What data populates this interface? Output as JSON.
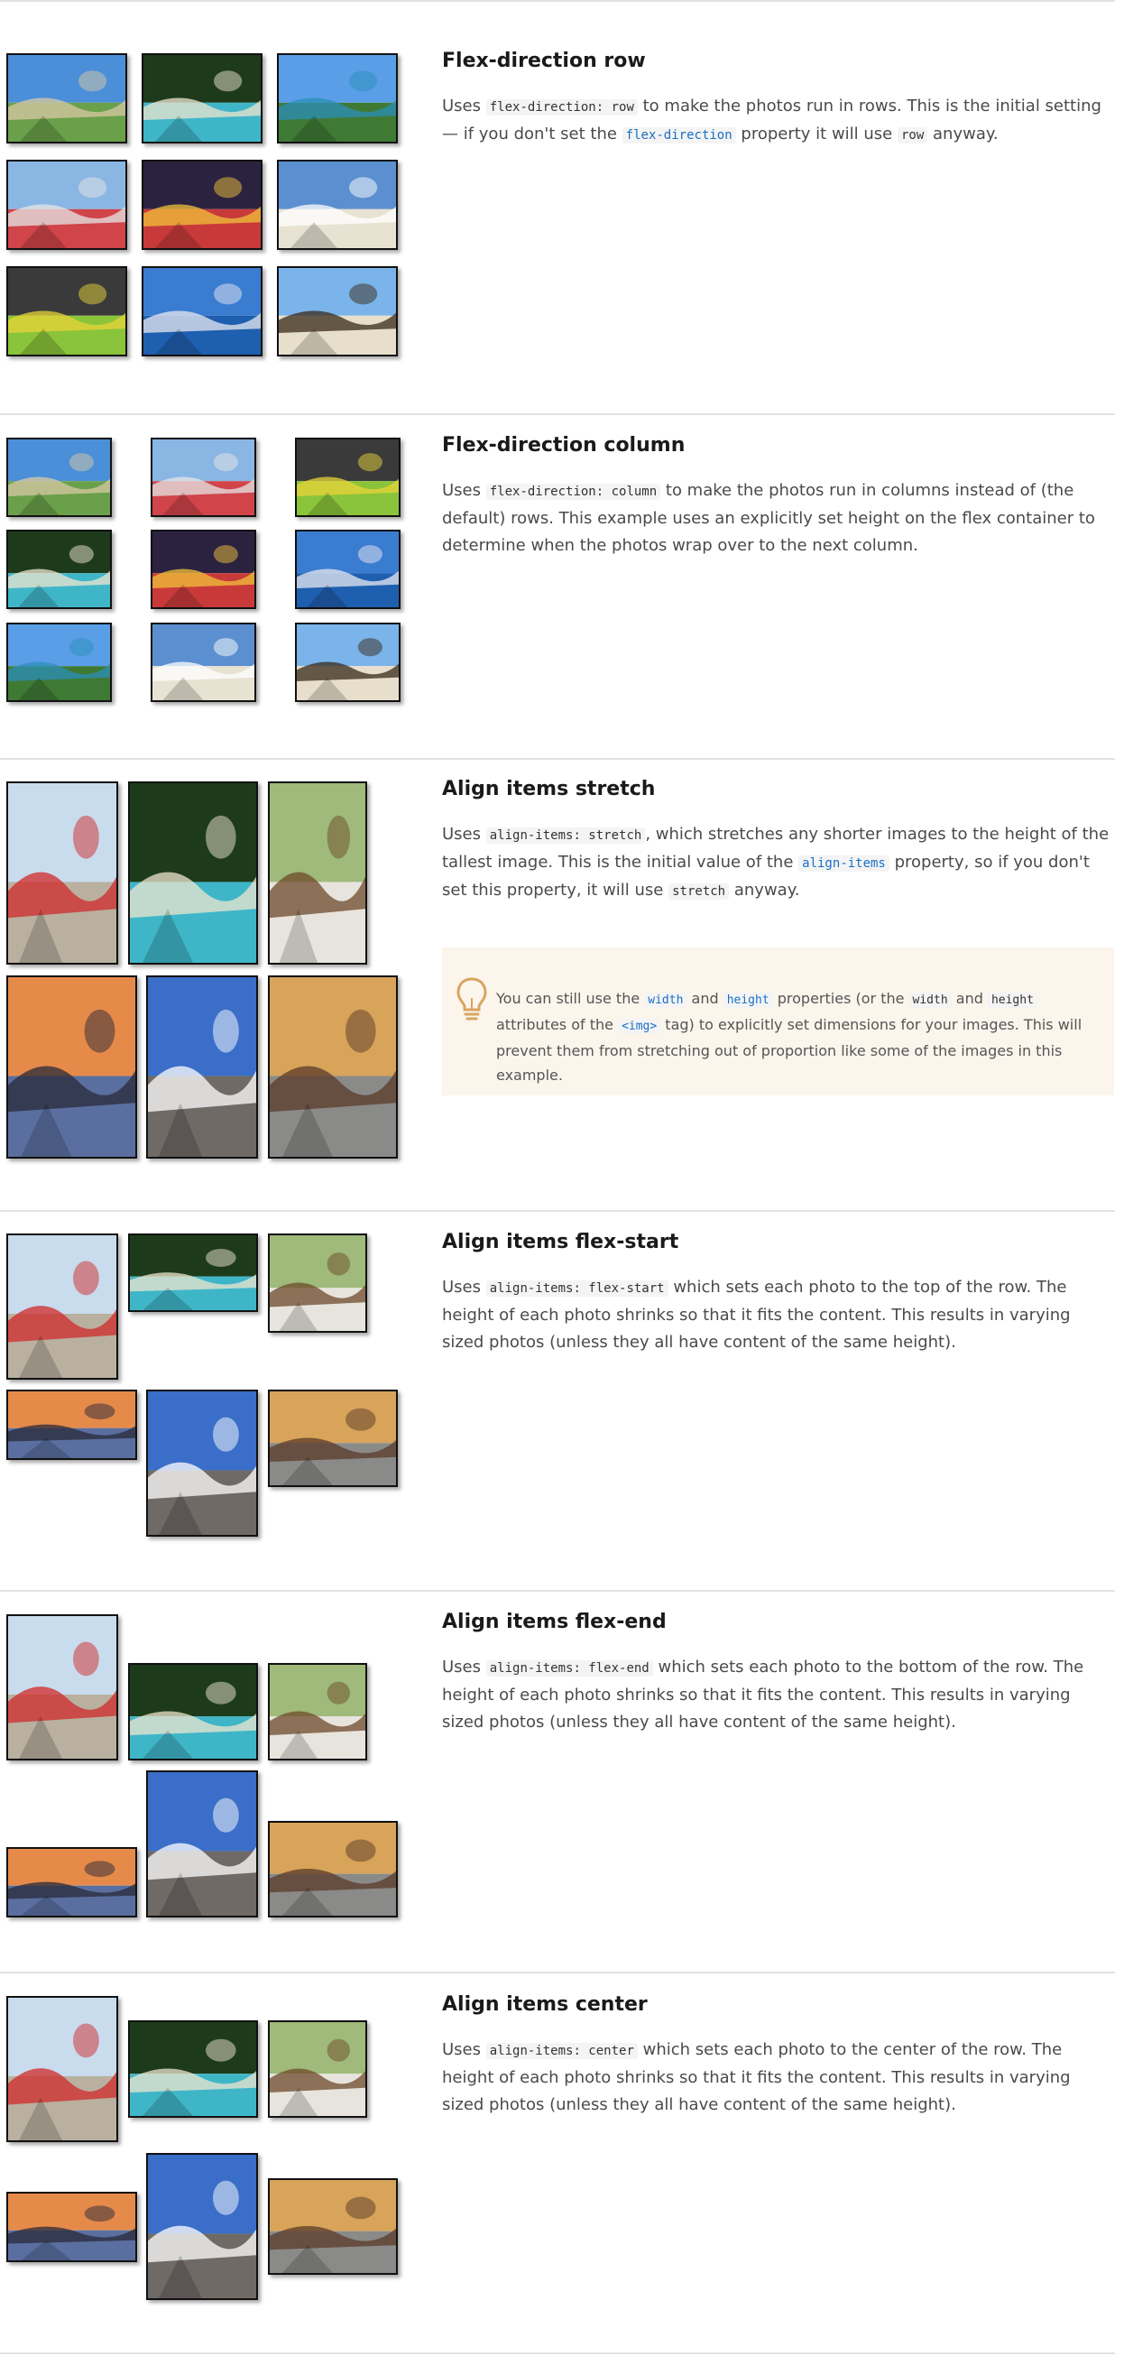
{
  "photo_kinds": {
    "path": {
      "sky": "#4a8fd8",
      "ground": "#6aa04a",
      "accent": "#d8c9a4"
    },
    "beach": {
      "sky": "#1d3b1a",
      "ground": "#3fb6c8",
      "accent": "#efe6cf"
    },
    "bay": {
      "sky": "#5a9ee8",
      "ground": "#3f7a35",
      "accent": "#2c8fb8"
    },
    "house": {
      "sky": "#8ab6e4",
      "ground": "#d0444a",
      "accent": "#e6e6e6"
    },
    "market": {
      "sky": "#2b2240",
      "ground": "#c83a3a",
      "accent": "#f2c13a"
    },
    "chairs": {
      "sky": "#5b8fcf",
      "ground": "#e8e2d2",
      "accent": "#ffffff"
    },
    "truck": {
      "sky": "#3a3a3a",
      "ground": "#8ac43a",
      "accent": "#e8d43a"
    },
    "pier": {
      "sky": "#3a7cd0",
      "ground": "#1f5fb0",
      "accent": "#e8e8f0"
    },
    "palm": {
      "sky": "#7ab4ea",
      "ground": "#e7dfcc",
      "accent": "#3a2a1a"
    },
    "flowers": {
      "sky": "#c9dcee",
      "ground": "#b9b0a0",
      "accent": "#d02a2a"
    },
    "bird": {
      "sky": "#9fba7a",
      "ground": "#e7e4dd",
      "accent": "#6e4a2a"
    },
    "sail": {
      "sky": "#e68a4a",
      "ground": "#5a6fa0",
      "accent": "#2a2a3a"
    },
    "river": {
      "sky": "#3a6ec8",
      "ground": "#6f6a66",
      "accent": "#ffffff"
    },
    "rickshaw": {
      "sky": "#d8a45a",
      "ground": "#8a8a88",
      "accent": "#5a3a2a"
    }
  },
  "sections": [
    {
      "title": "Flex-direction row",
      "description": [
        {
          "type": "text",
          "v": "Uses "
        },
        {
          "type": "code",
          "v": "flex-direction: row"
        },
        {
          "type": "text",
          "v": " to make the photos run in rows. This is the initial setting — if you don't set the "
        },
        {
          "type": "link",
          "v": "flex-direction"
        },
        {
          "type": "text",
          "v": " property it will use "
        },
        {
          "type": "code",
          "v": "row"
        },
        {
          "type": "text",
          "v": " anyway."
        }
      ],
      "photos": [
        "path",
        "beach",
        "bay",
        "house",
        "market",
        "chairs",
        "truck",
        "pier",
        "palm"
      ]
    },
    {
      "title": "Flex-direction column",
      "description": [
        {
          "type": "text",
          "v": "Uses "
        },
        {
          "type": "code",
          "v": "flex-direction: column"
        },
        {
          "type": "text",
          "v": " to make the photos run in columns instead of (the default) rows. This example uses an explicitly set height on the flex container to determine when the photos wrap over to the next column."
        }
      ],
      "photos": [
        "path",
        "house",
        "truck",
        "beach",
        "market",
        "pier",
        "bay",
        "chairs",
        "palm"
      ]
    },
    {
      "title": "Align items stretch",
      "description": [
        {
          "type": "text",
          "v": "Uses "
        },
        {
          "type": "code",
          "v": "align-items: stretch"
        },
        {
          "type": "text",
          "v": ", which stretches any shorter images to the height of the tallest image. This is the initial value of the "
        },
        {
          "type": "link",
          "v": "align-items"
        },
        {
          "type": "text",
          "v": " property, so if you don't set this property, it will use "
        },
        {
          "type": "code",
          "v": "stretch"
        },
        {
          "type": "text",
          "v": " anyway."
        }
      ],
      "photos": [
        "flowers",
        "beach",
        "bird",
        "sail",
        "river",
        "rickshaw"
      ]
    },
    {
      "title": "Align items flex-start",
      "description": [
        {
          "type": "text",
          "v": "Uses "
        },
        {
          "type": "code",
          "v": "align-items: flex-start"
        },
        {
          "type": "text",
          "v": " which sets each photo to the top of the row. The height of each photo shrinks so that it fits the content. This results in varying sized photos (unless they all have content of the same height)."
        }
      ],
      "photos": [
        "flowers",
        "beach",
        "bird",
        "sail",
        "river",
        "rickshaw"
      ]
    },
    {
      "title": "Align items flex-end",
      "description": [
        {
          "type": "text",
          "v": "Uses "
        },
        {
          "type": "code",
          "v": "align-items: flex-end"
        },
        {
          "type": "text",
          "v": " which sets each photo to the bottom of the row. The height of each photo shrinks so that it fits the content. This results in varying sized photos (unless they all have content of the same height)."
        }
      ],
      "photos": [
        "flowers",
        "beach",
        "bird",
        "sail",
        "river",
        "rickshaw"
      ]
    },
    {
      "title": "Align items center",
      "description": [
        {
          "type": "text",
          "v": "Uses "
        },
        {
          "type": "code",
          "v": "align-items: center"
        },
        {
          "type": "text",
          "v": " which sets each photo to the center of the row. The height of each photo shrinks so that it fits the content. This results in varying sized photos (unless they all have content of the same height)."
        }
      ],
      "photos": [
        "flowers",
        "beach",
        "bird",
        "sail",
        "river",
        "rickshaw"
      ]
    }
  ],
  "note": [
    {
      "type": "text",
      "v": "You can still use the "
    },
    {
      "type": "link",
      "v": "width"
    },
    {
      "type": "text",
      "v": " and "
    },
    {
      "type": "link",
      "v": "height"
    },
    {
      "type": "text",
      "v": " properties (or the "
    },
    {
      "type": "code",
      "v": "width"
    },
    {
      "type": "text",
      "v": " and "
    },
    {
      "type": "code",
      "v": "height"
    },
    {
      "type": "text",
      "v": " attributes of the "
    },
    {
      "type": "link",
      "v": "<img>"
    },
    {
      "type": "text",
      "v": " tag) to explicitly set dimensions for your images. This will prevent them from stretching out of proportion like some of the images in this example."
    }
  ],
  "note_icon": "lightbulb-icon"
}
